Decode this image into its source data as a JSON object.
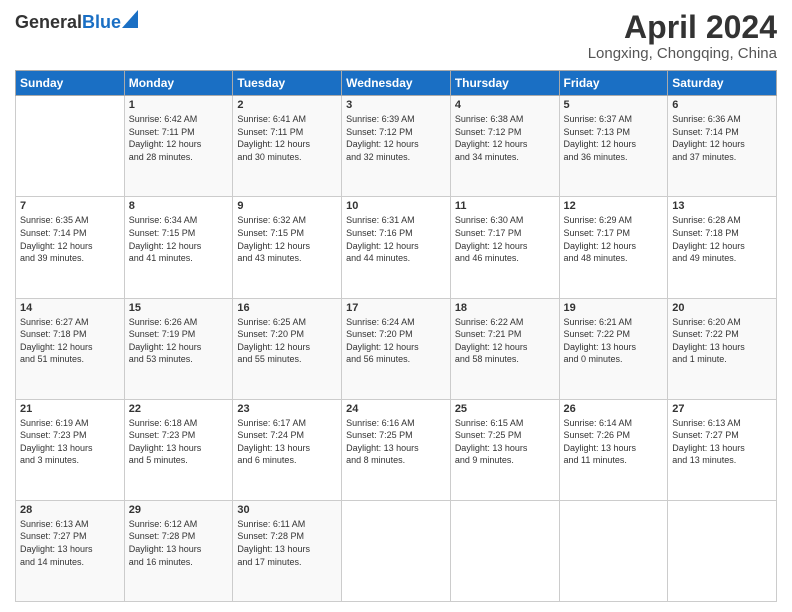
{
  "logo": {
    "general": "General",
    "blue": "Blue"
  },
  "header": {
    "month": "April 2024",
    "location": "Longxing, Chongqing, China"
  },
  "days_of_week": [
    "Sunday",
    "Monday",
    "Tuesday",
    "Wednesday",
    "Thursday",
    "Friday",
    "Saturday"
  ],
  "weeks": [
    [
      {
        "day": "",
        "info": ""
      },
      {
        "day": "1",
        "info": "Sunrise: 6:42 AM\nSunset: 7:11 PM\nDaylight: 12 hours\nand 28 minutes."
      },
      {
        "day": "2",
        "info": "Sunrise: 6:41 AM\nSunset: 7:11 PM\nDaylight: 12 hours\nand 30 minutes."
      },
      {
        "day": "3",
        "info": "Sunrise: 6:39 AM\nSunset: 7:12 PM\nDaylight: 12 hours\nand 32 minutes."
      },
      {
        "day": "4",
        "info": "Sunrise: 6:38 AM\nSunset: 7:12 PM\nDaylight: 12 hours\nand 34 minutes."
      },
      {
        "day": "5",
        "info": "Sunrise: 6:37 AM\nSunset: 7:13 PM\nDaylight: 12 hours\nand 36 minutes."
      },
      {
        "day": "6",
        "info": "Sunrise: 6:36 AM\nSunset: 7:14 PM\nDaylight: 12 hours\nand 37 minutes."
      }
    ],
    [
      {
        "day": "7",
        "info": "Sunrise: 6:35 AM\nSunset: 7:14 PM\nDaylight: 12 hours\nand 39 minutes."
      },
      {
        "day": "8",
        "info": "Sunrise: 6:34 AM\nSunset: 7:15 PM\nDaylight: 12 hours\nand 41 minutes."
      },
      {
        "day": "9",
        "info": "Sunrise: 6:32 AM\nSunset: 7:15 PM\nDaylight: 12 hours\nand 43 minutes."
      },
      {
        "day": "10",
        "info": "Sunrise: 6:31 AM\nSunset: 7:16 PM\nDaylight: 12 hours\nand 44 minutes."
      },
      {
        "day": "11",
        "info": "Sunrise: 6:30 AM\nSunset: 7:17 PM\nDaylight: 12 hours\nand 46 minutes."
      },
      {
        "day": "12",
        "info": "Sunrise: 6:29 AM\nSunset: 7:17 PM\nDaylight: 12 hours\nand 48 minutes."
      },
      {
        "day": "13",
        "info": "Sunrise: 6:28 AM\nSunset: 7:18 PM\nDaylight: 12 hours\nand 49 minutes."
      }
    ],
    [
      {
        "day": "14",
        "info": "Sunrise: 6:27 AM\nSunset: 7:18 PM\nDaylight: 12 hours\nand 51 minutes."
      },
      {
        "day": "15",
        "info": "Sunrise: 6:26 AM\nSunset: 7:19 PM\nDaylight: 12 hours\nand 53 minutes."
      },
      {
        "day": "16",
        "info": "Sunrise: 6:25 AM\nSunset: 7:20 PM\nDaylight: 12 hours\nand 55 minutes."
      },
      {
        "day": "17",
        "info": "Sunrise: 6:24 AM\nSunset: 7:20 PM\nDaylight: 12 hours\nand 56 minutes."
      },
      {
        "day": "18",
        "info": "Sunrise: 6:22 AM\nSunset: 7:21 PM\nDaylight: 12 hours\nand 58 minutes."
      },
      {
        "day": "19",
        "info": "Sunrise: 6:21 AM\nSunset: 7:22 PM\nDaylight: 13 hours\nand 0 minutes."
      },
      {
        "day": "20",
        "info": "Sunrise: 6:20 AM\nSunset: 7:22 PM\nDaylight: 13 hours\nand 1 minute."
      }
    ],
    [
      {
        "day": "21",
        "info": "Sunrise: 6:19 AM\nSunset: 7:23 PM\nDaylight: 13 hours\nand 3 minutes."
      },
      {
        "day": "22",
        "info": "Sunrise: 6:18 AM\nSunset: 7:23 PM\nDaylight: 13 hours\nand 5 minutes."
      },
      {
        "day": "23",
        "info": "Sunrise: 6:17 AM\nSunset: 7:24 PM\nDaylight: 13 hours\nand 6 minutes."
      },
      {
        "day": "24",
        "info": "Sunrise: 6:16 AM\nSunset: 7:25 PM\nDaylight: 13 hours\nand 8 minutes."
      },
      {
        "day": "25",
        "info": "Sunrise: 6:15 AM\nSunset: 7:25 PM\nDaylight: 13 hours\nand 9 minutes."
      },
      {
        "day": "26",
        "info": "Sunrise: 6:14 AM\nSunset: 7:26 PM\nDaylight: 13 hours\nand 11 minutes."
      },
      {
        "day": "27",
        "info": "Sunrise: 6:13 AM\nSunset: 7:27 PM\nDaylight: 13 hours\nand 13 minutes."
      }
    ],
    [
      {
        "day": "28",
        "info": "Sunrise: 6:13 AM\nSunset: 7:27 PM\nDaylight: 13 hours\nand 14 minutes."
      },
      {
        "day": "29",
        "info": "Sunrise: 6:12 AM\nSunset: 7:28 PM\nDaylight: 13 hours\nand 16 minutes."
      },
      {
        "day": "30",
        "info": "Sunrise: 6:11 AM\nSunset: 7:28 PM\nDaylight: 13 hours\nand 17 minutes."
      },
      {
        "day": "",
        "info": ""
      },
      {
        "day": "",
        "info": ""
      },
      {
        "day": "",
        "info": ""
      },
      {
        "day": "",
        "info": ""
      }
    ]
  ]
}
